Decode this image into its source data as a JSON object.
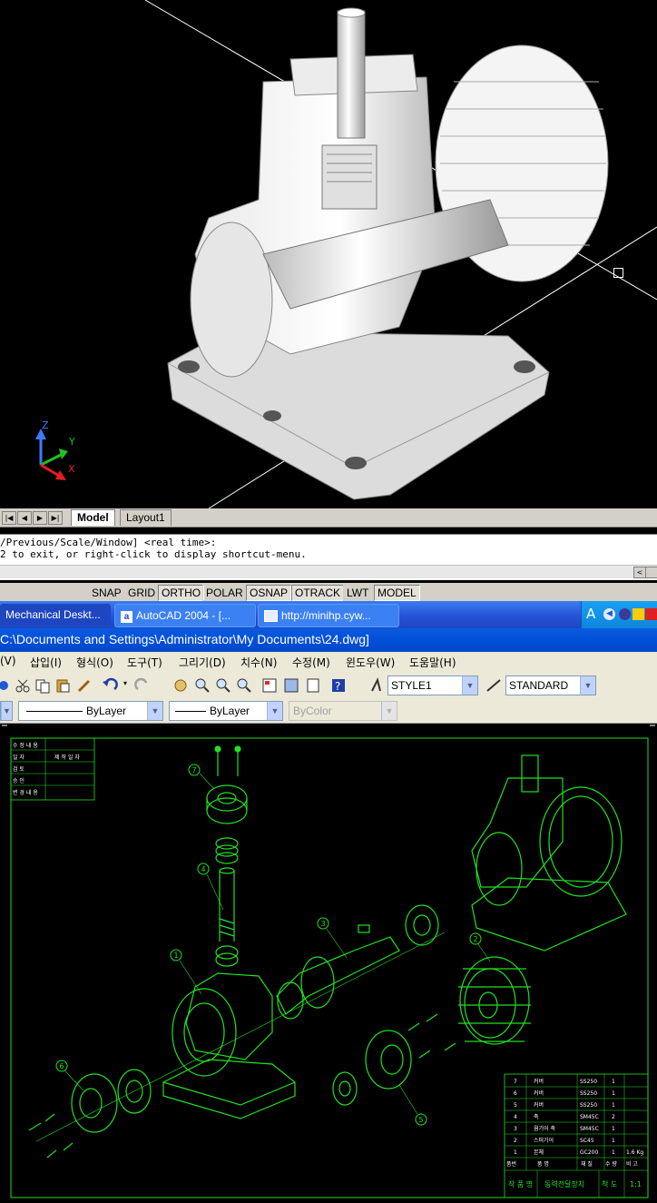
{
  "viewport_top": {
    "ucs": {
      "z": "Z",
      "y": "Y",
      "x": "X"
    }
  },
  "layout_tabs": {
    "model": "Model",
    "layout1": "Layout1"
  },
  "command": {
    "line1": "/Previous/Scale/Window] <real time>:",
    "line2": "2 to exit, or right-click to display shortcut-menu."
  },
  "status_buttons": [
    {
      "label": "SNAP",
      "on": false
    },
    {
      "label": "GRID",
      "on": false
    },
    {
      "label": "ORTHO",
      "on": true
    },
    {
      "label": "POLAR",
      "on": false
    },
    {
      "label": "OSNAP",
      "on": true
    },
    {
      "label": "OTRACK",
      "on": true
    },
    {
      "label": "LWT",
      "on": false
    },
    {
      "label": "MODEL",
      "on": true
    }
  ],
  "taskbar": {
    "items": [
      {
        "label": "Mechanical Deskt..."
      },
      {
        "label": "AutoCAD 2004 - [..."
      },
      {
        "label": "http://minihp.cyw..."
      }
    ],
    "tray_letter": "A"
  },
  "window_title": "C:\\Documents and Settings\\Administrator\\My Documents\\24.dwg]",
  "menu": {
    "items": [
      "(V)",
      "삽입(I)",
      "형식(O)",
      "도구(T)",
      "그리기(D)",
      "치수(N)",
      "수정(M)",
      "윈도우(W)",
      "도움말(H)"
    ]
  },
  "toolbar": {
    "text_style": "STYLE1",
    "dim_style": "STANDARD",
    "linetype": "ByLayer",
    "lineweight": "ByLayer",
    "plotstyle": "ByColor"
  },
  "drawing": {
    "balloons": [
      "7",
      "4",
      "1",
      "3",
      "2",
      "6",
      "5"
    ],
    "title_block": {
      "rows": [
        {
          "no": "7",
          "name": "커버",
          "mat": "SS250",
          "qty": "1",
          "note": ""
        },
        {
          "no": "6",
          "name": "커버",
          "mat": "SS250",
          "qty": "1",
          "note": ""
        },
        {
          "no": "5",
          "name": "커버",
          "mat": "SS250",
          "qty": "1",
          "note": ""
        },
        {
          "no": "4",
          "name": "축",
          "mat": "SM45C",
          "qty": "2",
          "note": ""
        },
        {
          "no": "3",
          "name": "웜기어 축",
          "mat": "SM45C",
          "qty": "1",
          "note": ""
        },
        {
          "no": "2",
          "name": "스퍼기어",
          "mat": "SC45",
          "qty": "1",
          "note": ""
        },
        {
          "no": "1",
          "name": "본체",
          "mat": "GC200",
          "qty": "1",
          "note": "1.6 Kg"
        }
      ],
      "header": [
        "품번",
        "품 명",
        "재 질",
        "수 량",
        "비 고"
      ],
      "footer": {
        "label": "작 품 명",
        "title": "동력전달장치",
        "scale_label": "척 도",
        "scale": "1:1"
      }
    },
    "revision_block": [
      "수 정 내 용",
      "일 자",
      "검 토",
      "승 인",
      "변 경 내 용",
      "제 작 일 자"
    ]
  },
  "colors": {
    "drawing_green": "#22e022",
    "cad_bg": "#000000",
    "xp_blue": "#0350d8"
  }
}
